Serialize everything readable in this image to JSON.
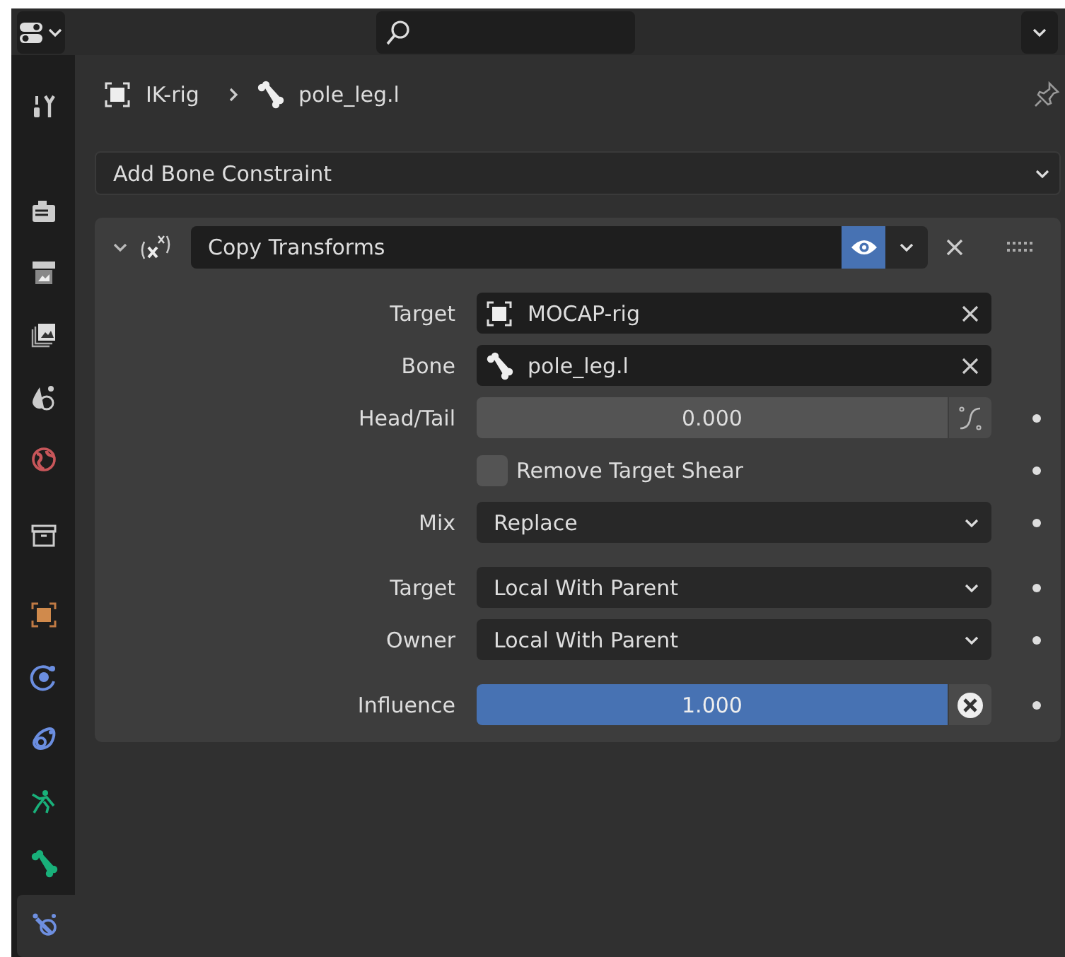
{
  "header": {
    "editor_type_menu": {
      "expanded": false
    }
  },
  "tab_groups": [
    [
      {
        "selected": false
      }
    ],
    [
      {
        "selected": false
      },
      {
        "selected": false
      },
      {
        "selected": false
      },
      {
        "selected": false
      },
      {
        "selected": false
      }
    ],
    [
      {
        "selected": false
      }
    ],
    [
      {
        "selected": false
      },
      {
        "selected": false
      },
      {
        "selected": false
      },
      {
        "selected": false
      },
      {
        "selected": false
      },
      {
        "selected": true
      }
    ]
  ],
  "breadcrumb": [
    "IK-rig",
    "pole_leg.l"
  ],
  "add_constraint_menu": "Add Bone Constraint",
  "constraint": {
    "name": "Copy Transforms",
    "expanded": true,
    "enabled": true,
    "groups": [
      [
        {
          "kind": "object",
          "label": "Target",
          "value": "MOCAP-rig"
        },
        {
          "kind": "bone",
          "label": "Bone",
          "value": "pole_leg.l"
        },
        {
          "kind": "number",
          "label": "Head/Tail",
          "value": "0.000"
        },
        {
          "kind": "checkbox",
          "label": "Remove Target Shear",
          "checked": false
        },
        {
          "kind": "dropdown",
          "label": "Mix",
          "value": "Replace"
        }
      ],
      [
        {
          "kind": "dropdown",
          "label": "Target",
          "value": "Local With Parent"
        },
        {
          "kind": "dropdown",
          "label": "Owner",
          "value": "Local With Parent"
        }
      ],
      [
        {
          "kind": "slider",
          "label": "Influence",
          "value": "1.000",
          "level": 1
        }
      ]
    ]
  }
}
